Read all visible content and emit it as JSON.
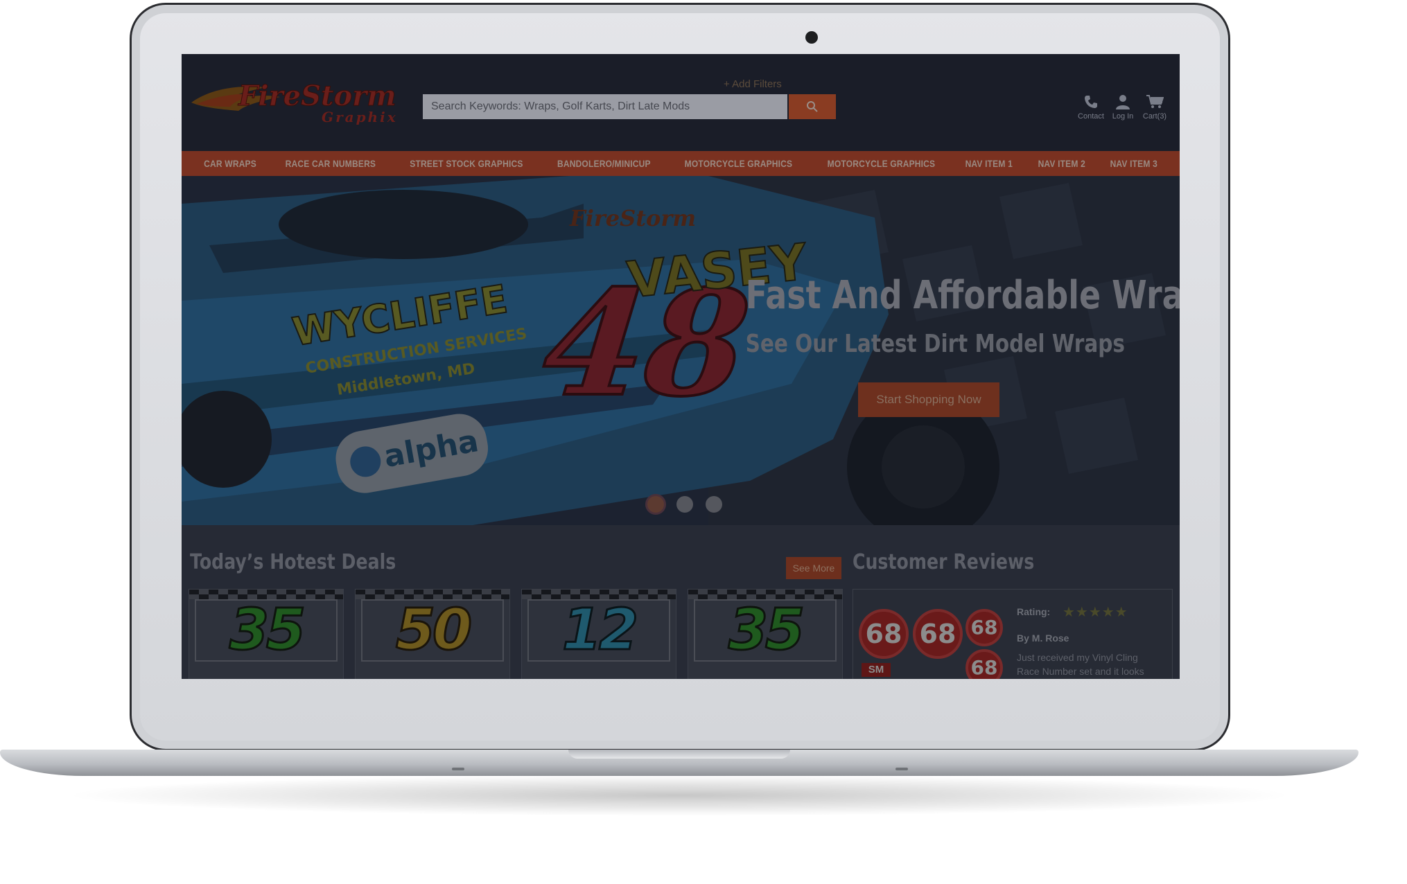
{
  "site": {
    "logo_text_main": "FireStorm",
    "logo_text_sub": "Graphix"
  },
  "search": {
    "add_filters": "+ Add Filters",
    "placeholder": "Search Keywords: Wraps, Golf Karts, Dirt Late Mods"
  },
  "header_icons": {
    "contact": "Contact",
    "login": "Log In",
    "cart": "Cart(3)"
  },
  "nav": {
    "items": [
      "CAR WRAPS",
      "RACE CAR NUMBERS",
      "STREET STOCK GRAPHICS",
      "BANDOLERO/MINICUP",
      "MOTORCYCLE GRAPHICS",
      "MOTORCYCLE GRAPHICS",
      "NAV ITEM 1",
      "NAV ITEM 2",
      "NAV ITEM 3"
    ]
  },
  "hero": {
    "title": "Fast And Affordable Wraps",
    "subtitle": "See Our Latest Dirt Model Wraps",
    "button": "Start Shopping Now",
    "car_number": "48",
    "car_text_1": "WYCLIFFE",
    "car_text_2": "CONSTRUCTION SERVICES",
    "car_text_3": "Middletown, MD",
    "car_text_4": "alpha",
    "slides": 3,
    "active_slide": 1
  },
  "deals": {
    "title": "Today’s Hotest Deals",
    "see_more": "See More",
    "items": [
      {
        "number": "35",
        "color": "#2f8a2a"
      },
      {
        "number": "50",
        "color": "#a8862a"
      },
      {
        "number": "12",
        "color": "#2a86a0"
      },
      {
        "number": "35",
        "color": "#2f8a2a"
      }
    ]
  },
  "reviews": {
    "title": "Customer Reviews",
    "rating_label": "Rating:",
    "stars": "★★★★★",
    "author": "By M. Rose",
    "text": "Just received my Vinyl Cling Race Number set and it looks",
    "badge_number": "68",
    "badge_sm": "SM"
  },
  "colors": {
    "brand_red": "#b8402a",
    "accent_orange": "#e06a3a"
  }
}
